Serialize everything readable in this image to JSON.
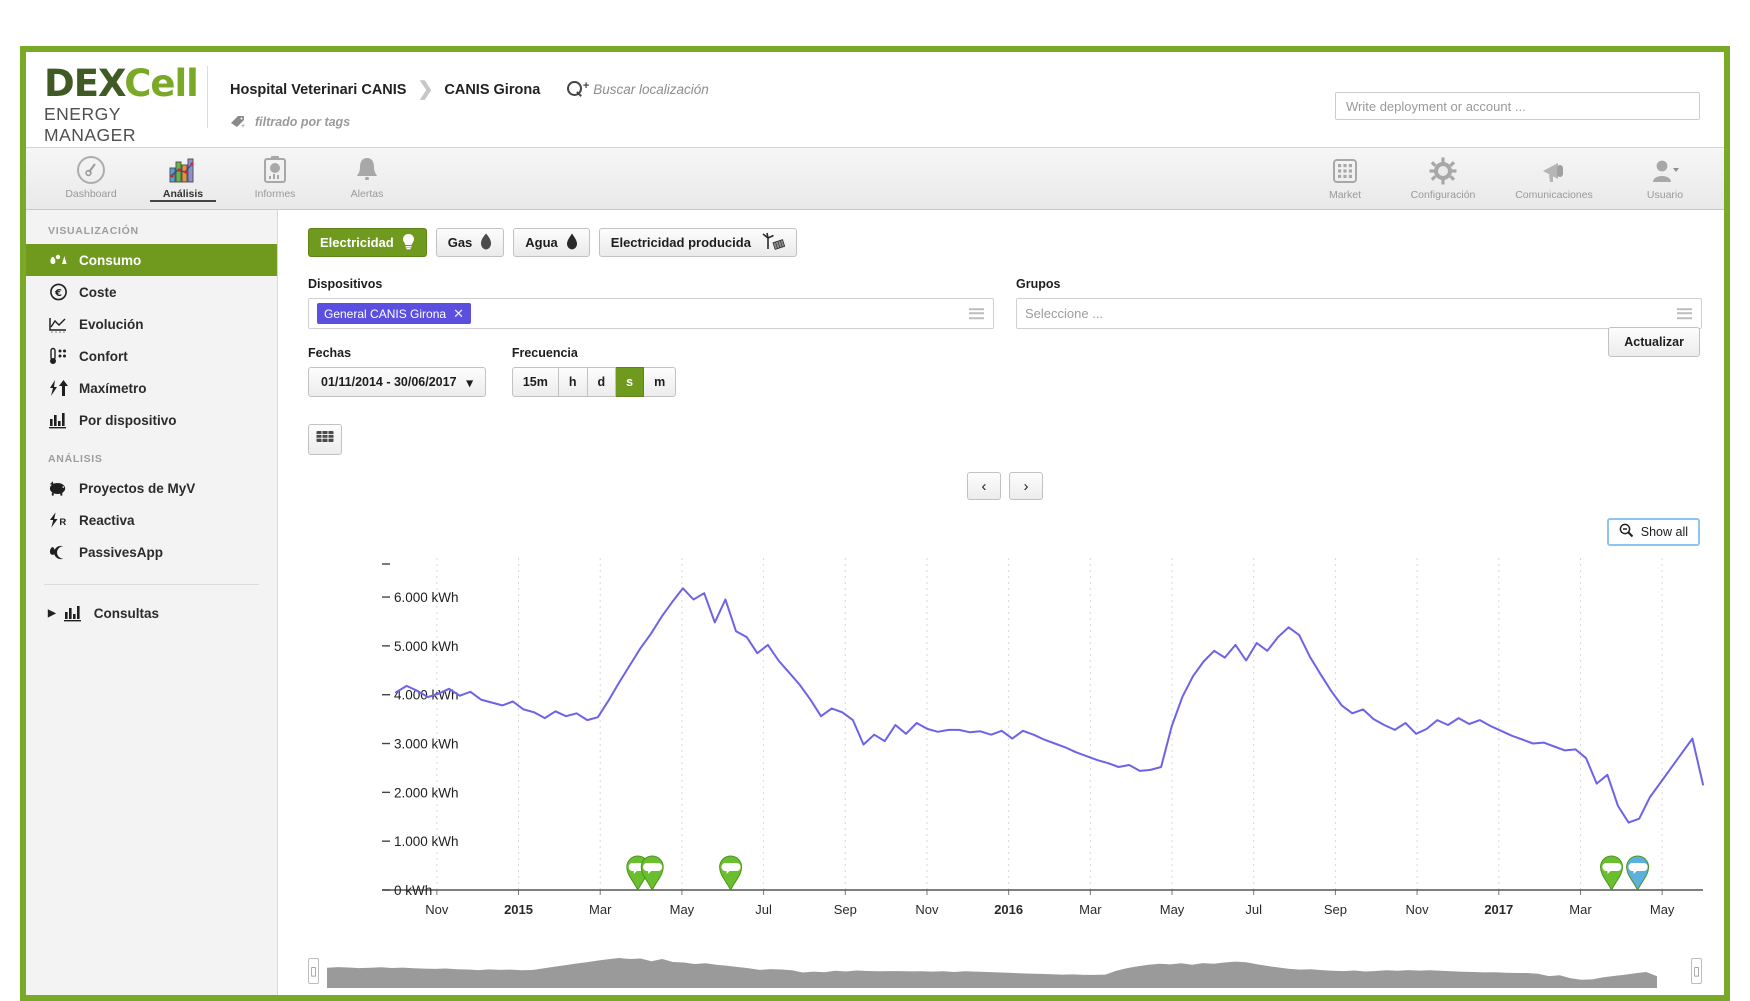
{
  "brand": {
    "name_dark": "DEX",
    "name_light": "Cell",
    "subtitle": "ENERGY MANAGER"
  },
  "header": {
    "breadcrumb": [
      "Hospital Veterinari CANIS",
      "CANIS Girona"
    ],
    "search_location_text": "Buscar localización",
    "tag_filter_text": "filtrado por tags",
    "account_search_placeholder": "Write deployment or account ..."
  },
  "topnav": {
    "left": [
      {
        "label": "Dashboard",
        "icon": "gauge-icon",
        "active": false
      },
      {
        "label": "Análisis",
        "icon": "bar-chart-icon",
        "active": true
      },
      {
        "label": "Informes",
        "icon": "clipboard-report-icon",
        "active": false
      },
      {
        "label": "Alertas",
        "icon": "bell-icon",
        "active": false
      }
    ],
    "right": [
      {
        "label": "Market",
        "icon": "grid-icon"
      },
      {
        "label": "Configuración",
        "icon": "gear-icon"
      },
      {
        "label": "Comunicaciones",
        "icon": "megaphone-icon"
      },
      {
        "label": "Usuario",
        "icon": "user-icon"
      }
    ]
  },
  "sidebar": {
    "section1_title": "VISUALIZACIÓN",
    "section1_items": [
      {
        "label": "Consumo",
        "icon": "consumption-icon",
        "selected": true
      },
      {
        "label": "Coste",
        "icon": "euro-icon",
        "selected": false
      },
      {
        "label": "Evolución",
        "icon": "evolution-chart-icon",
        "selected": false
      },
      {
        "label": "Confort",
        "icon": "thermometer-icon",
        "selected": false
      },
      {
        "label": "Maxímetro",
        "icon": "bolt-up-icon",
        "selected": false
      },
      {
        "label": "Por dispositivo",
        "icon": "device-bars-icon",
        "selected": false
      }
    ],
    "section2_title": "ANÁLISIS",
    "section2_items": [
      {
        "label": "Proyectos de MyV",
        "icon": "piggy-bank-icon",
        "selected": false
      },
      {
        "label": "Reactiva",
        "icon": "bolt-r-icon",
        "selected": false
      },
      {
        "label": "PassivesApp",
        "icon": "moon-leaf-icon",
        "selected": false
      }
    ],
    "expandable": {
      "label": "Consultas",
      "icon": "queries-bars-icon",
      "caret": "▶"
    }
  },
  "main": {
    "tabs": [
      {
        "label": "Electricidad",
        "icon": "lightbulb-icon",
        "active": true
      },
      {
        "label": "Gas",
        "icon": "flame-icon",
        "active": false
      },
      {
        "label": "Agua",
        "icon": "water-drop-icon",
        "active": false
      },
      {
        "label": "Electricidad producida",
        "icon": "wind-solar-icon",
        "active": false
      }
    ],
    "devices": {
      "label": "Dispositivos",
      "chip": "General CANIS Girona",
      "chip_remove": "✕"
    },
    "groups": {
      "label": "Grupos",
      "placeholder": "Seleccione ..."
    },
    "dates": {
      "label": "Fechas",
      "value": "01/11/2014 - 30/06/2017",
      "caret": "▾"
    },
    "frequency": {
      "label": "Frecuencia",
      "options": [
        "15m",
        "h",
        "d",
        "s",
        "m"
      ],
      "selected": "s"
    },
    "update_button": "Actualizar",
    "solar_button_icon": "solar-panel-icon",
    "prev_button": "‹",
    "next_button": "›",
    "show_all": {
      "label": "Show all",
      "icon": "zoom-out-icon"
    }
  },
  "chart_data": {
    "type": "line",
    "title": "",
    "xlabel": "",
    "ylabel": "kWh",
    "unit": "kWh",
    "grid": true,
    "legend": "none",
    "series_color": "#6c63e8",
    "ylim": [
      0,
      6800
    ],
    "ytick_labels": [
      "0 kWh",
      "1.000 kWh",
      "2.000 kWh",
      "3.000 kWh",
      "4.000 kWh",
      "5.000 kWh",
      "6.000 kWh"
    ],
    "ytick_values": [
      0,
      1000,
      2000,
      3000,
      4000,
      5000,
      6000
    ],
    "xtick_labels": [
      "Nov",
      "2015",
      "Mar",
      "May",
      "Jul",
      "Sep",
      "Nov",
      "2016",
      "Mar",
      "May",
      "Jul",
      "Sep",
      "Nov",
      "2017",
      "Mar",
      "May"
    ],
    "x_start": "2014-11",
    "x_end": "2017-06",
    "values": [
      4050,
      4180,
      4080,
      3950,
      4020,
      4120,
      3980,
      4060,
      3900,
      3840,
      3780,
      3860,
      3700,
      3640,
      3520,
      3660,
      3560,
      3620,
      3480,
      3540,
      3880,
      4250,
      4600,
      4950,
      5250,
      5600,
      5900,
      6180,
      5950,
      6080,
      5480,
      5950,
      5300,
      5180,
      4850,
      5020,
      4700,
      4450,
      4200,
      3900,
      3560,
      3720,
      3640,
      3480,
      2980,
      3180,
      3050,
      3380,
      3200,
      3420,
      3300,
      3240,
      3280,
      3280,
      3230,
      3250,
      3180,
      3260,
      3100,
      3260,
      3180,
      3080,
      3000,
      2920,
      2820,
      2740,
      2660,
      2600,
      2520,
      2560,
      2440,
      2460,
      2520,
      3350,
      3950,
      4380,
      4680,
      4900,
      4760,
      5020,
      4700,
      5060,
      4900,
      5180,
      5380,
      5220,
      4780,
      4420,
      4080,
      3780,
      3620,
      3700,
      3500,
      3380,
      3280,
      3420,
      3200,
      3300,
      3480,
      3380,
      3520,
      3400,
      3480,
      3360,
      3260,
      3160,
      3080,
      3000,
      3020,
      2940,
      2860,
      2880,
      2700,
      2180,
      2360,
      1720,
      1380,
      1460,
      1900,
      2200,
      2500,
      2800,
      3100,
      2160
    ],
    "markers": [
      {
        "position_pct": 18.5,
        "color": "#6abf2e",
        "type": "comment-marker"
      },
      {
        "position_pct": 19.6,
        "color": "#6abf2e",
        "type": "comment-marker"
      },
      {
        "position_pct": 25.6,
        "color": "#6abf2e",
        "type": "comment-marker"
      },
      {
        "position_pct": 93.0,
        "color": "#6abf2e",
        "type": "comment-marker"
      },
      {
        "position_pct": 95.0,
        "color": "#5bb0dd",
        "type": "comment-marker"
      }
    ]
  }
}
